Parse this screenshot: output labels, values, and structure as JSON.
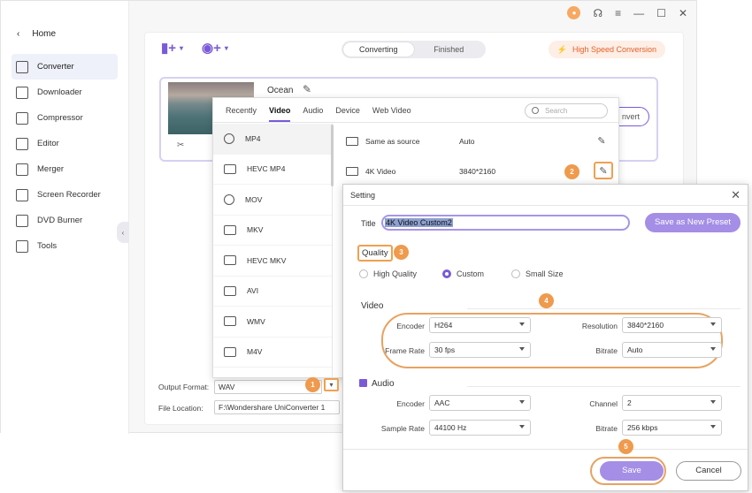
{
  "sidebar": {
    "home": "Home",
    "items": [
      {
        "label": "Converter",
        "icon": "converter-icon"
      },
      {
        "label": "Downloader",
        "icon": "downloader-icon"
      },
      {
        "label": "Compressor",
        "icon": "compressor-icon"
      },
      {
        "label": "Editor",
        "icon": "editor-icon"
      },
      {
        "label": "Merger",
        "icon": "merger-icon"
      },
      {
        "label": "Screen Recorder",
        "icon": "screen-recorder-icon"
      },
      {
        "label": "DVD Burner",
        "icon": "dvd-burner-icon"
      },
      {
        "label": "Tools",
        "icon": "tools-icon"
      }
    ]
  },
  "toolbar": {
    "tab_converting": "Converting",
    "tab_finished": "Finished",
    "high_speed": "High Speed Conversion"
  },
  "file": {
    "name": "Ocean",
    "convert_label": "nvert"
  },
  "output": {
    "format_label": "Output Format:",
    "format_value": "WAV",
    "location_label": "File Location:",
    "location_value": "F:\\Wondershare UniConverter 1"
  },
  "format_panel": {
    "tabs": [
      "Recently",
      "Video",
      "Audio",
      "Device",
      "Web Video"
    ],
    "search_placeholder": "Search",
    "formats": [
      "MP4",
      "HEVC MP4",
      "MOV",
      "MKV",
      "HEVC MKV",
      "AVI",
      "WMV",
      "M4V"
    ],
    "qualities": [
      {
        "name": "Same as source",
        "res": "Auto"
      },
      {
        "name": "4K Video",
        "res": "3840*2160"
      }
    ]
  },
  "setting": {
    "header": "Setting",
    "title_label": "Title",
    "title_value": "4K Video Custom2",
    "save_preset": "Save as New Preset",
    "quality_label": "Quality",
    "quality_options": [
      "High Quality",
      "Custom",
      "Small Size"
    ],
    "video_section": "Video",
    "encoder_label": "Encoder",
    "encoder_value": "H264",
    "resolution_label": "Resolution",
    "resolution_value": "3840*2160",
    "framerate_label": "Frame Rate",
    "framerate_value": "30 fps",
    "bitrate_label": "Bitrate",
    "bitrate_value": "Auto",
    "audio_section": "Audio",
    "a_encoder_value": "AAC",
    "channel_label": "Channel",
    "channel_value": "2",
    "samplerate_label": "Sample Rate",
    "samplerate_value": "44100 Hz",
    "a_bitrate_value": "256 kbps",
    "save": "Save",
    "cancel": "Cancel"
  },
  "badges": [
    "1",
    "2",
    "3",
    "4",
    "5"
  ],
  "colors": {
    "accent": "#7a5ad8",
    "highlight": "#ef9a4c",
    "button": "#a48ee6"
  }
}
